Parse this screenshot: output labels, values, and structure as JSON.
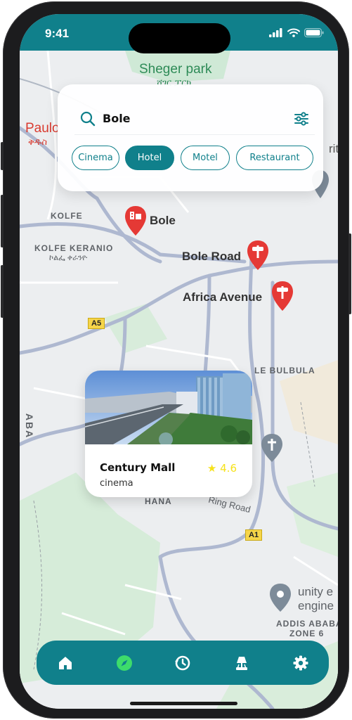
{
  "status_bar": {
    "time": "9:41"
  },
  "search": {
    "query": "Bole"
  },
  "filters": [
    {
      "label": "Cinema",
      "active": false
    },
    {
      "label": "Hotel",
      "active": true
    },
    {
      "label": "Motel",
      "active": false
    },
    {
      "label": "Restaurant",
      "active": false
    }
  ],
  "map": {
    "labels": {
      "sheger_park": "Sheger park",
      "sheger_park_amharic": "ሸገር ፓርክ",
      "paulo": "Paulo",
      "paulo_amharic": "ቅዱስ",
      "kolfe": "KOLFE",
      "kolfe_keranio": "KOLFE KERANIO",
      "kolfe_keranio_amharic": "ኮልፌ ቀራንዮ",
      "a5": "A5",
      "a1": "A1",
      "le_bulbula": "LE BULBULA",
      "hana": "HANA",
      "ring_road": "Ring Road",
      "aba": "ABA",
      "unity_line1": "unity e",
      "unity_line2": "engine",
      "addis_line1": "ADDIS ABABA",
      "addis_line2": "ZONE 6",
      "ritis": "ritis"
    },
    "pins": [
      {
        "label": "Bole",
        "icon": "hotel-icon"
      },
      {
        "label": "Bole Road",
        "icon": "hospital-sign-icon"
      },
      {
        "label": "Africa Avenue",
        "icon": "hospital-sign-icon"
      }
    ]
  },
  "place_card": {
    "name": "Century Mall",
    "type": "cinema",
    "rating_star": "★",
    "rating": "4.6"
  },
  "nav": [
    {
      "icon": "home-icon",
      "active": false
    },
    {
      "icon": "compass-icon",
      "active": true
    },
    {
      "icon": "history-icon",
      "active": false
    },
    {
      "icon": "lamp-icon",
      "active": false
    },
    {
      "icon": "settings-icon",
      "active": false
    }
  ],
  "colors": {
    "primary": "#10808b",
    "pin_red": "#e53935",
    "star": "#f6e21a",
    "compass_active": "#3ddc6b"
  }
}
